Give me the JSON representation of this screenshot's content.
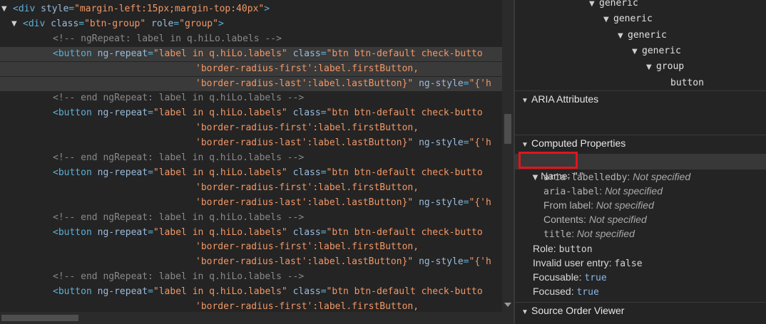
{
  "code_lines": [
    {
      "indent": 18,
      "tri": "▼",
      "parts": [
        [
          "tag",
          "<div "
        ],
        [
          "attr",
          "style"
        ],
        [
          "tag",
          "="
        ],
        [
          "val",
          "\"margin-left:15px;margin-top:40px\""
        ],
        [
          "tag",
          ">"
        ]
      ]
    },
    {
      "indent": 32,
      "tri": "▼",
      "parts": [
        [
          "tag",
          "<div "
        ],
        [
          "attr",
          "class"
        ],
        [
          "tag",
          "="
        ],
        [
          "val",
          "\"btn-group\""
        ],
        [
          "attr",
          " role"
        ],
        [
          "tag",
          "="
        ],
        [
          "val",
          "\"group\""
        ],
        [
          "tag",
          ">"
        ]
      ]
    },
    {
      "indent": 74,
      "parts": [
        [
          "cm",
          "<!-- ngRepeat: label in q.hiLo.labels -->"
        ]
      ]
    },
    {
      "indent": 74,
      "hl": true,
      "parts": [
        [
          "tag",
          "<button "
        ],
        [
          "attr",
          "ng-repeat"
        ],
        [
          "tag",
          "="
        ],
        [
          "val",
          "\"label in q.hiLo.labels\""
        ],
        [
          "attr",
          " class"
        ],
        [
          "tag",
          "="
        ],
        [
          "val",
          "\"btn btn-default check-butto"
        ]
      ]
    },
    {
      "indent": 274,
      "hl": true,
      "parts": [
        [
          "val",
          "'border-radius-first':label.firstButton,"
        ]
      ]
    },
    {
      "indent": 274,
      "hl": true,
      "parts": [
        [
          "val",
          "'border-radius-last':label.lastButton}\""
        ],
        [
          "attr",
          " ng-style"
        ],
        [
          "tag",
          "="
        ],
        [
          "val",
          "\"{'h"
        ]
      ]
    },
    {
      "indent": 74,
      "parts": [
        [
          "cm",
          "<!-- end ngRepeat: label in q.hiLo.labels -->"
        ]
      ]
    },
    {
      "indent": 74,
      "parts": [
        [
          "tag",
          "<button "
        ],
        [
          "attr",
          "ng-repeat"
        ],
        [
          "tag",
          "="
        ],
        [
          "val",
          "\"label in q.hiLo.labels\""
        ],
        [
          "attr",
          " class"
        ],
        [
          "tag",
          "="
        ],
        [
          "val",
          "\"btn btn-default check-butto"
        ]
      ]
    },
    {
      "indent": 274,
      "parts": [
        [
          "val",
          "'border-radius-first':label.firstButton,"
        ]
      ]
    },
    {
      "indent": 274,
      "parts": [
        [
          "val",
          "'border-radius-last':label.lastButton}\""
        ],
        [
          "attr",
          " ng-style"
        ],
        [
          "tag",
          "="
        ],
        [
          "val",
          "\"{'h"
        ]
      ]
    },
    {
      "indent": 74,
      "parts": [
        [
          "cm",
          "<!-- end ngRepeat: label in q.hiLo.labels -->"
        ]
      ]
    },
    {
      "indent": 74,
      "parts": [
        [
          "tag",
          "<button "
        ],
        [
          "attr",
          "ng-repeat"
        ],
        [
          "tag",
          "="
        ],
        [
          "val",
          "\"label in q.hiLo.labels\""
        ],
        [
          "attr",
          " class"
        ],
        [
          "tag",
          "="
        ],
        [
          "val",
          "\"btn btn-default check-butto"
        ]
      ]
    },
    {
      "indent": 274,
      "parts": [
        [
          "val",
          "'border-radius-first':label.firstButton,"
        ]
      ]
    },
    {
      "indent": 274,
      "parts": [
        [
          "val",
          "'border-radius-last':label.lastButton}\""
        ],
        [
          "attr",
          " ng-style"
        ],
        [
          "tag",
          "="
        ],
        [
          "val",
          "\"{'h"
        ]
      ]
    },
    {
      "indent": 74,
      "parts": [
        [
          "cm",
          "<!-- end ngRepeat: label in q.hiLo.labels -->"
        ]
      ]
    },
    {
      "indent": 74,
      "parts": [
        [
          "tag",
          "<button "
        ],
        [
          "attr",
          "ng-repeat"
        ],
        [
          "tag",
          "="
        ],
        [
          "val",
          "\"label in q.hiLo.labels\""
        ],
        [
          "attr",
          " class"
        ],
        [
          "tag",
          "="
        ],
        [
          "val",
          "\"btn btn-default check-butto"
        ]
      ]
    },
    {
      "indent": 274,
      "parts": [
        [
          "val",
          "'border-radius-first':label.firstButton,"
        ]
      ]
    },
    {
      "indent": 274,
      "parts": [
        [
          "val",
          "'border-radius-last':label.lastButton}\""
        ],
        [
          "attr",
          " ng-style"
        ],
        [
          "tag",
          "="
        ],
        [
          "val",
          "\"{'h"
        ]
      ]
    },
    {
      "indent": 74,
      "parts": [
        [
          "cm",
          "<!-- end ngRepeat: label in q.hiLo.labels -->"
        ]
      ]
    },
    {
      "indent": 74,
      "parts": [
        [
          "tag",
          "<button "
        ],
        [
          "attr",
          "ng-repeat"
        ],
        [
          "tag",
          "="
        ],
        [
          "val",
          "\"label in q.hiLo.labels\""
        ],
        [
          "attr",
          " class"
        ],
        [
          "tag",
          "="
        ],
        [
          "val",
          "\"btn btn-default check-butto"
        ]
      ]
    },
    {
      "indent": 274,
      "parts": [
        [
          "val",
          "'border-radius-first':label.firstButton,"
        ]
      ]
    }
  ],
  "tree": {
    "items": [
      {
        "tri": "▼",
        "label": "generic"
      },
      {
        "tri": "▼",
        "label": "generic"
      },
      {
        "tri": "▼",
        "label": "generic"
      },
      {
        "tri": "▼",
        "label": "generic"
      },
      {
        "tri": "▼",
        "label": "group"
      },
      {
        "tri": "",
        "label": "button"
      }
    ]
  },
  "sections": {
    "aria": "ARIA Attributes",
    "computed": "Computed Properties",
    "source_order": "Source Order Viewer"
  },
  "computed": {
    "name_label": "Name:",
    "name_value": "\"\"",
    "sub": [
      {
        "key": "aria-labelledby",
        "mono": true,
        "value": "Not specified"
      },
      {
        "key": "aria-label",
        "mono": true,
        "value": "Not specified"
      },
      {
        "key": "From label",
        "mono": false,
        "value": "Not specified"
      },
      {
        "key": "Contents",
        "mono": false,
        "value": "Not specified"
      },
      {
        "key": "title",
        "mono": true,
        "value": "Not specified"
      }
    ],
    "props": [
      {
        "key": "Role",
        "value": "button",
        "blue": false
      },
      {
        "key": "Invalid user entry",
        "value": "false",
        "blue": false
      },
      {
        "key": "Focusable",
        "value": "true",
        "blue": true
      },
      {
        "key": "Focused",
        "value": "true",
        "blue": true
      }
    ]
  },
  "colors": {
    "highlight_box": "#e1141c",
    "tag": "#5db0d7",
    "attr": "#9bbbdc",
    "value": "#f29766",
    "comment": "#898989"
  }
}
